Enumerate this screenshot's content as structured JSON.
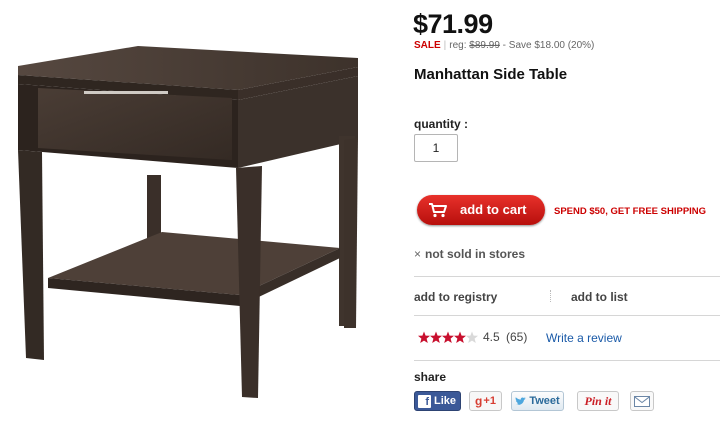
{
  "product": {
    "price": "$71.99",
    "sale_label": "SALE",
    "reg_prefix": "reg:",
    "reg_price": "$89.99",
    "save_text": "- Save  $18.00  (20%)",
    "title": "Manhattan Side Table",
    "image_icon": "side-table-photo"
  },
  "purchase": {
    "quantity_label": "quantity :",
    "quantity_value": "1",
    "add_to_cart_label": "add to cart",
    "free_shipping": "SPEND $50, GET FREE SHIPPING",
    "not_sold_icon": "×",
    "not_sold_text": "not sold in stores"
  },
  "actions": {
    "registry_label": "add to registry",
    "list_label": "add to list"
  },
  "rating": {
    "stars_value": 4.5,
    "stars_max": 5,
    "rating_text": "4.5",
    "count_text": "(65)",
    "review_link": "Write a review"
  },
  "share": {
    "label": "share",
    "facebook_label": "Like",
    "google_label": "+1",
    "twitter_label": "Tweet",
    "pinterest_label": "Pin it",
    "email_icon": "envelope-icon"
  },
  "colors": {
    "accent_red": "#cc0000",
    "link_blue": "#1a5aa8",
    "facebook_blue": "#3b5998",
    "wood_dark": "#3e322b"
  }
}
